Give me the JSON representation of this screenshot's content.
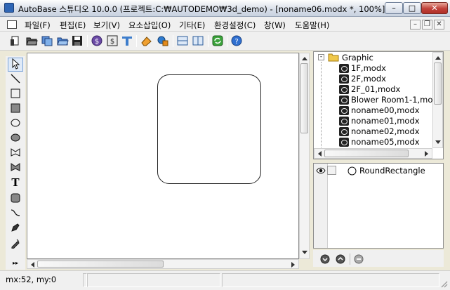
{
  "window": {
    "title": "AutoBase 스튜디오 10.0.0 (프로젝트:C:₩AUTODEMO₩3d_demo) - [noname06.modx *, 100%]",
    "minimize_label": "–",
    "maximize_label": "□",
    "close_label": "✕"
  },
  "menu": {
    "items": [
      "파일(F)",
      "편집(E)",
      "보기(V)",
      "요소삽입(O)",
      "기타(E)",
      "환경설정(C)",
      "창(W)",
      "도움말(H)"
    ],
    "mdi_minimize": "–",
    "mdi_restore": "❐",
    "mdi_close": "✕"
  },
  "toolbar": {
    "icons": [
      "new-document-icon",
      "open-folder-icon",
      "save-copy-icon",
      "open-project-icon",
      "save-icon",
      "dollar-script-icon",
      "dollar-variable-icon",
      "text-style-icon",
      "eraser-icon",
      "component-icon",
      "split-horizontal-icon",
      "split-vertical-icon",
      "refresh-icon",
      "help-icon"
    ]
  },
  "palette": {
    "tools": [
      "select-arrow-icon",
      "line-icon",
      "rectangle-icon",
      "filled-rectangle-icon",
      "ellipse-icon",
      "filled-ellipse-icon",
      "polygon-icon",
      "filled-polygon-icon",
      "text-tool-icon",
      "rounded-rectangle-icon",
      "curve-icon",
      "pen-icon",
      "eyedropper-icon"
    ],
    "text_tool_glyph": "T",
    "more_label": "▸▸"
  },
  "tree": {
    "root_label": "Graphic",
    "files": [
      "1F,modx",
      "2F,modx",
      "2F_01,modx",
      "Blower Room1-1,modx",
      "noname00,modx",
      "noname01,modx",
      "noname02,modx",
      "noname05,modx"
    ],
    "selected_index": 0
  },
  "layers": {
    "items": [
      {
        "label": "RoundRectangle"
      }
    ]
  },
  "status": {
    "coords": "mx:52, my:0"
  },
  "colors": {
    "title_gradient_top": "#fdfdfd",
    "close_button": "#c0413a",
    "folder": "#f0c84a",
    "selection": "#dfeaf8"
  }
}
